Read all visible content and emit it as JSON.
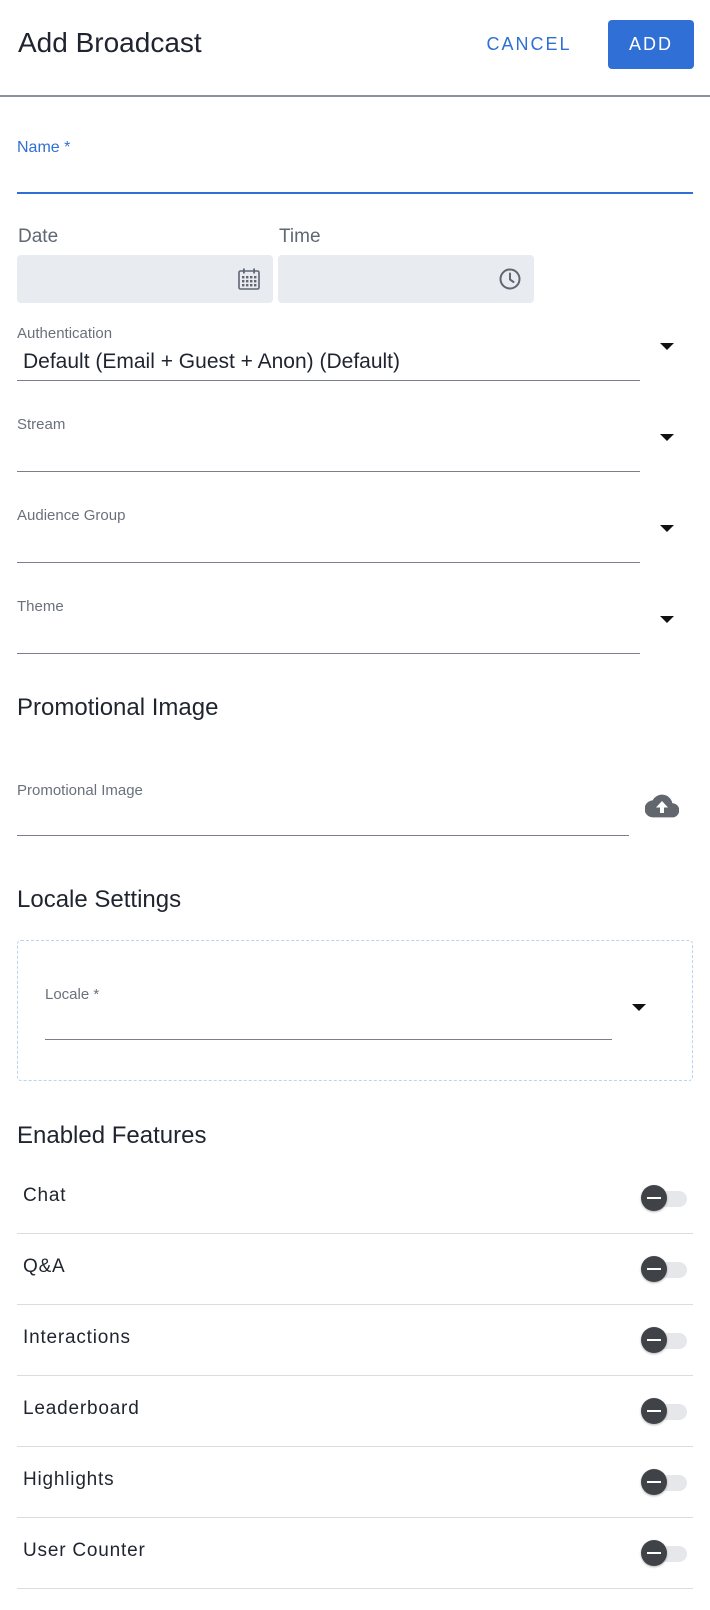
{
  "header": {
    "title": "Add Broadcast",
    "cancel_label": "CANCEL",
    "add_label": "ADD"
  },
  "form": {
    "name_label": "Name *",
    "date_label": "Date",
    "time_label": "Time",
    "authentication": {
      "label": "Authentication",
      "value": "Default (Email + Guest + Anon)  (Default)"
    },
    "stream": {
      "label": "Stream",
      "value": ""
    },
    "audience_group": {
      "label": "Audience Group",
      "value": ""
    },
    "theme": {
      "label": "Theme",
      "value": ""
    }
  },
  "promotional": {
    "section_title": "Promotional Image",
    "field_label": "Promotional Image"
  },
  "locale": {
    "section_title": "Locale Settings",
    "field_label": "Locale *"
  },
  "features": {
    "section_title": "Enabled Features",
    "items": [
      {
        "label": "Chat",
        "state": "indeterminate"
      },
      {
        "label": "Q&A",
        "state": "indeterminate"
      },
      {
        "label": "Interactions",
        "state": "indeterminate"
      },
      {
        "label": "Leaderboard",
        "state": "indeterminate"
      },
      {
        "label": "Highlights",
        "state": "indeterminate"
      },
      {
        "label": "User Counter",
        "state": "indeterminate"
      }
    ]
  },
  "colors": {
    "accent": "#2f6fd6",
    "filled_bg": "#e8ebef",
    "toggle_knob": "#3f4348"
  }
}
